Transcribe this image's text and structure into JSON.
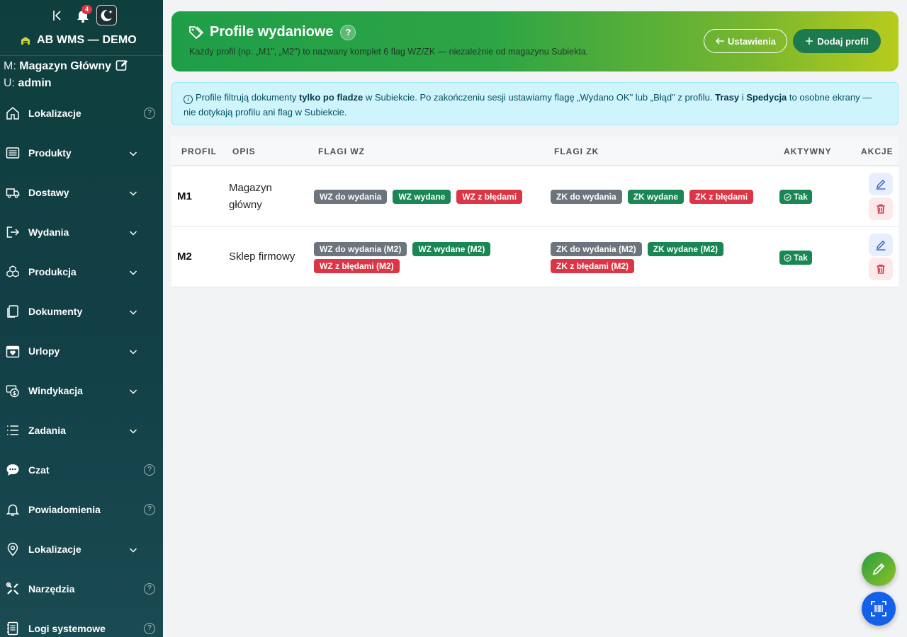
{
  "header": {
    "notifications_count": "4",
    "brand": "AB WMS — DEMO"
  },
  "user_meta": {
    "warehouse_label": "M:",
    "warehouse": "Magazyn Główny",
    "user_label": "U:",
    "user": "admin"
  },
  "sidebar": {
    "items": [
      {
        "label": "Lokalizacje",
        "icon": "home-icon",
        "trail": "help"
      },
      {
        "label": "Produkty",
        "icon": "list-icon",
        "trail": "chevron"
      },
      {
        "label": "Dostawy",
        "icon": "truck-icon",
        "trail": "chevron"
      },
      {
        "label": "Wydania",
        "icon": "exit-icon",
        "trail": "chevron"
      },
      {
        "label": "Produkcja",
        "icon": "boxes-icon",
        "trail": "chevron"
      },
      {
        "label": "Dokumenty",
        "icon": "copy-icon",
        "trail": "chevron"
      },
      {
        "label": "Urlopy",
        "icon": "calendar-heart-icon",
        "trail": "chevron"
      },
      {
        "label": "Windykacja",
        "icon": "cash-icon",
        "trail": "chevron"
      },
      {
        "label": "Zadania",
        "icon": "tasks-icon",
        "trail": "chevron"
      },
      {
        "label": "Czat",
        "icon": "chat-icon",
        "trail": "help"
      },
      {
        "label": "Powiadomienia",
        "icon": "bell-icon",
        "trail": "help"
      },
      {
        "label": "Lokalizacje",
        "icon": "map-pin-icon",
        "trail": "chevron"
      },
      {
        "label": "Narzędzia",
        "icon": "tools-icon",
        "trail": "help"
      },
      {
        "label": "Logi systemowe",
        "icon": "journal-icon",
        "trail": "help"
      }
    ],
    "help_glyph": "?"
  },
  "banner": {
    "title": "Profile wydaniowe",
    "help_glyph": "?",
    "subtitle": "Każdy profil (np. „M1\", „M2\") to nazwany komplet 6 flag WZ/ZK — niezależnie od magazynu Subiekta.",
    "settings_label": "Ustawienia",
    "add_label": "Dodaj profil"
  },
  "info": {
    "t1": "Profile filtrują dokumenty ",
    "b1": "tylko po fladze",
    "t2": " w Subiekcie. Po zakończeniu sesji ustawiamy flagę „Wydano OK\" lub „Błąd\" z profilu. ",
    "b2": "Trasy",
    "t3": " i ",
    "b3": "Spedycja",
    "t4": " to osobne ekrany — nie dotykają profilu ani flag w Subiekcie."
  },
  "table": {
    "headers": {
      "profil": "PROFIL",
      "opis": "OPIS",
      "wz": "FLAGI WZ",
      "zk": "FLAGI ZK",
      "active": "AKTYWNY",
      "actions": "AKCJE"
    },
    "rows": [
      {
        "code": "M1",
        "opis": "Magazyn główny",
        "wz": [
          "WZ do wydania",
          "WZ wydane",
          "WZ z błędami"
        ],
        "zk": [
          "ZK do wydania",
          "ZK wydane",
          "ZK z błędami"
        ],
        "active": "Tak"
      },
      {
        "code": "M2",
        "opis": "Sklep firmowy",
        "wz": [
          "WZ do wydania (M2)",
          "WZ wydane (M2)",
          "WZ z błędami (M2)"
        ],
        "zk": [
          "ZK do wydania (M2)",
          "ZK wydane (M2)",
          "ZK z błędami (M2)"
        ],
        "active": "Tak"
      }
    ]
  },
  "colors": {
    "sidebar_bg": "#0f3f3d",
    "banner_start": "#1f9e48",
    "banner_end": "#b7cc1d",
    "flag_pending": "#6c757d",
    "flag_done": "#198754",
    "flag_error": "#dc3545",
    "scan_button": "#1560e8"
  }
}
